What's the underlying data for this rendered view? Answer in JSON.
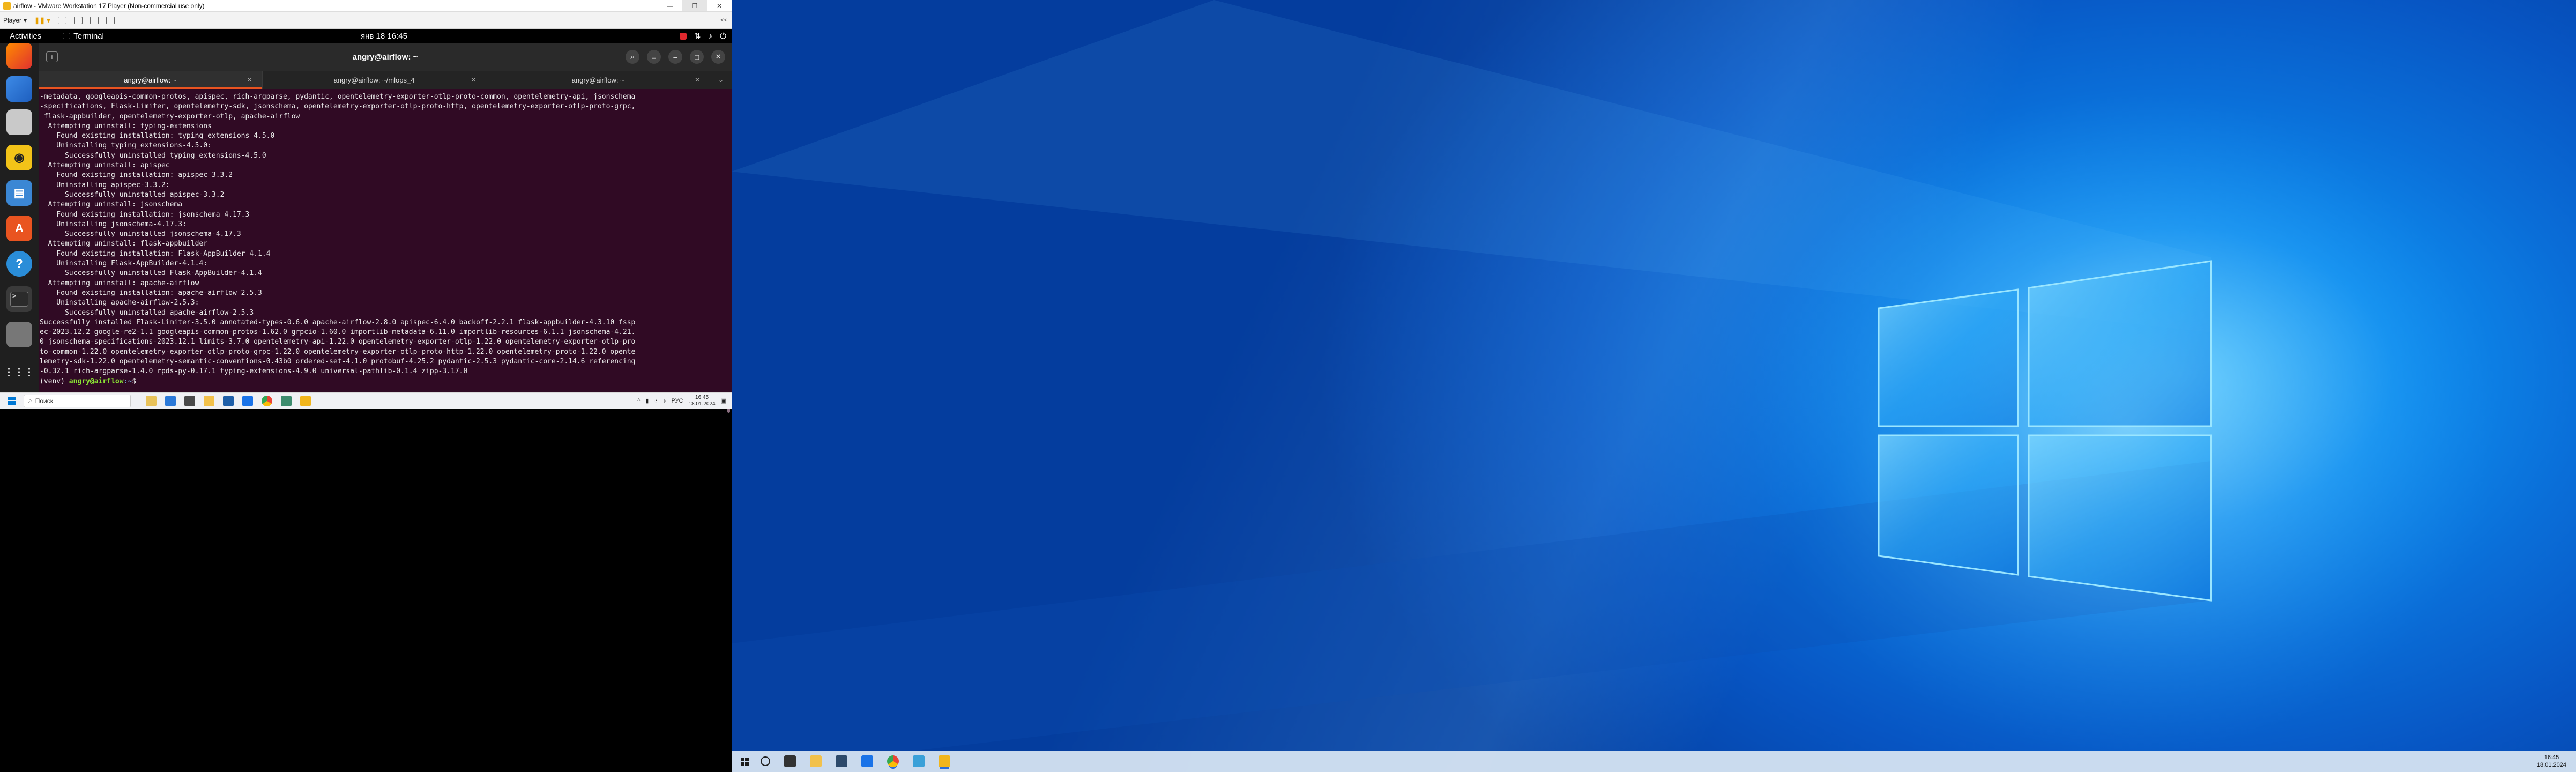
{
  "vmware": {
    "title": "airflow - VMware Workstation 17 Player (Non-commercial use only)",
    "player_menu": "Player",
    "toolbar_right": "<<"
  },
  "gnome": {
    "activities": "Activities",
    "app_name": "Terminal",
    "clock": "янв 18  16:45"
  },
  "terminal": {
    "window_title": "angry@airflow: ~",
    "tabs": [
      {
        "label": "angry@airflow: ~",
        "active": true
      },
      {
        "label": "angry@airflow: ~/mlops_4",
        "active": false
      },
      {
        "label": "angry@airflow: ~",
        "active": false
      }
    ],
    "lines": [
      "-metadata, googleapis-common-protos, apispec, rich-argparse, pydantic, opentelemetry-exporter-otlp-proto-common, opentelemetry-api, jsonschema",
      "-specifications, Flask-Limiter, opentelemetry-sdk, jsonschema, opentelemetry-exporter-otlp-proto-http, opentelemetry-exporter-otlp-proto-grpc,",
      " flask-appbuilder, opentelemetry-exporter-otlp, apache-airflow",
      "  Attempting uninstall: typing-extensions",
      "    Found existing installation: typing_extensions 4.5.0",
      "    Uninstalling typing_extensions-4.5.0:",
      "      Successfully uninstalled typing_extensions-4.5.0",
      "  Attempting uninstall: apispec",
      "    Found existing installation: apispec 3.3.2",
      "    Uninstalling apispec-3.3.2:",
      "      Successfully uninstalled apispec-3.3.2",
      "  Attempting uninstall: jsonschema",
      "    Found existing installation: jsonschema 4.17.3",
      "    Uninstalling jsonschema-4.17.3:",
      "      Successfully uninstalled jsonschema-4.17.3",
      "  Attempting uninstall: flask-appbuilder",
      "    Found existing installation: Flask-AppBuilder 4.1.4",
      "    Uninstalling Flask-AppBuilder-4.1.4:",
      "      Successfully uninstalled Flask-AppBuilder-4.1.4",
      "  Attempting uninstall: apache-airflow",
      "    Found existing installation: apache-airflow 2.5.3",
      "    Uninstalling apache-airflow-2.5.3:",
      "      Successfully uninstalled apache-airflow-2.5.3",
      "Successfully installed Flask-Limiter-3.5.0 annotated-types-0.6.0 apache-airflow-2.8.0 apispec-6.4.0 backoff-2.2.1 flask-appbuilder-4.3.10 fssp",
      "ec-2023.12.2 google-re2-1.1 googleapis-common-protos-1.62.0 grpcio-1.60.0 importlib-metadata-6.11.0 importlib-resources-6.1.1 jsonschema-4.21.",
      "0 jsonschema-specifications-2023.12.1 limits-3.7.0 opentelemetry-api-1.22.0 opentelemetry-exporter-otlp-1.22.0 opentelemetry-exporter-otlp-pro",
      "to-common-1.22.0 opentelemetry-exporter-otlp-proto-grpc-1.22.0 opentelemetry-exporter-otlp-proto-http-1.22.0 opentelemetry-proto-1.22.0 opente",
      "lemetry-sdk-1.22.0 opentelemetry-semantic-conventions-0.43b0 ordered-set-4.1.0 protobuf-4.25.2 pydantic-2.5.3 pydantic-core-2.14.6 referencing",
      "-0.32.1 rich-argparse-1.4.0 rpds-py-0.17.1 typing-extensions-4.9.0 universal-pathlib-0.1.4 zipp-3.17.0"
    ],
    "prompt": {
      "venv": "(venv) ",
      "user": "angry@airflow",
      "path": ":~",
      "symbol": "$ "
    }
  },
  "vm_taskbar": {
    "search_placeholder": "Поиск",
    "lang": "РУС",
    "time": "16:45",
    "date": "18.01.2024"
  },
  "desktop_taskbar": {
    "time": "16:45",
    "date": "18.01.2024"
  },
  "colors": {
    "terminal_bg": "#300a24",
    "ubuntu_accent": "#e95420",
    "windows_blue": "#0078d4"
  }
}
